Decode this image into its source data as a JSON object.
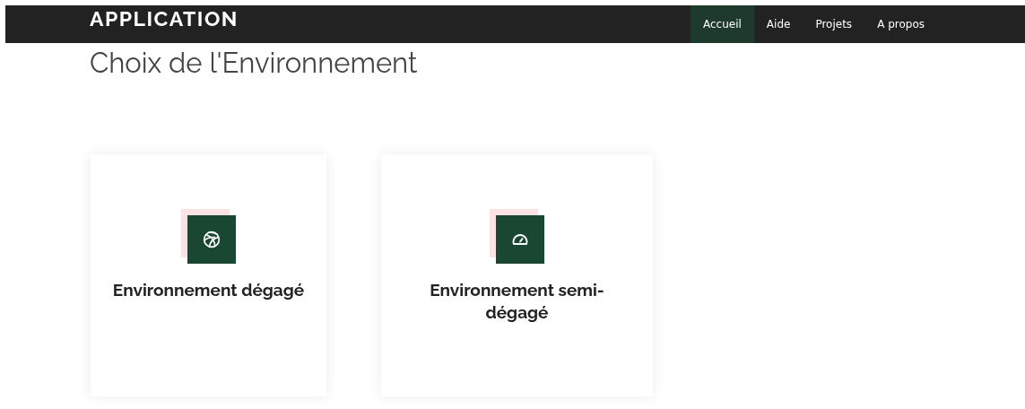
{
  "navbar": {
    "brand": "APPLICATION",
    "links": [
      {
        "label": "Accueil",
        "selected": true
      },
      {
        "label": "Aide",
        "selected": false
      },
      {
        "label": "Projets",
        "selected": false
      },
      {
        "label": "A propos",
        "selected": false
      }
    ]
  },
  "heading": "Choix de l'Environnement",
  "cards": [
    {
      "kind": "ball",
      "title": "Environnement dégagé"
    },
    {
      "kind": "gauge",
      "title": "Environnement semi-dégagé"
    }
  ]
}
